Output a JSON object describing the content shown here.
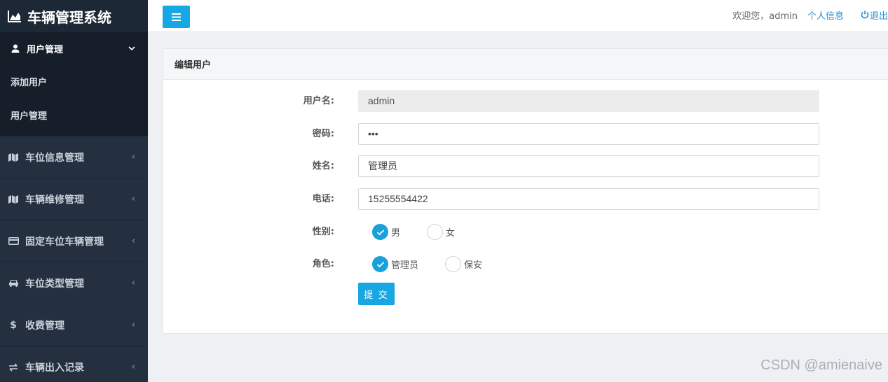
{
  "app": {
    "title": "车辆管理系统",
    "logo_icon": "area-chart-icon"
  },
  "sidebar": {
    "open_menu": {
      "label": "用户管理",
      "icon": "user-icon",
      "expanded": true,
      "items": [
        {
          "label": "添加用户"
        },
        {
          "label": "用户管理"
        }
      ]
    },
    "items": [
      {
        "label": "车位信息管理",
        "icon": "map-icon"
      },
      {
        "label": "车辆维修管理",
        "icon": "map-icon"
      },
      {
        "label": "固定车位车辆管理",
        "icon": "credit-card-icon"
      },
      {
        "label": "车位类型管理",
        "icon": "car-icon"
      },
      {
        "label": "收费管理",
        "icon": "dollar-icon"
      },
      {
        "label": "车辆出入记录",
        "icon": "exchange-icon"
      }
    ]
  },
  "topbar": {
    "menu_toggle_icon": "bars-icon",
    "welcome": "欢迎您，admin",
    "profile_link": "个人信息",
    "logout_link": "退出",
    "logout_icon": "power-icon"
  },
  "form": {
    "title": "编辑用户",
    "fields": {
      "username": {
        "label": "用户名:",
        "value": "admin",
        "disabled": true
      },
      "password": {
        "label": "密码:",
        "value": "•••"
      },
      "name": {
        "label": "姓名:",
        "value": "管理员"
      },
      "phone": {
        "label": "电话:",
        "value": "15255554422"
      }
    },
    "gender": {
      "label": "性别:",
      "options": [
        {
          "label": "男",
          "checked": true
        },
        {
          "label": "女",
          "checked": false
        }
      ]
    },
    "role": {
      "label": "角色:",
      "options": [
        {
          "label": "管理员",
          "checked": true
        },
        {
          "label": "保安",
          "checked": false
        }
      ]
    },
    "submit_label": "提 交"
  },
  "watermark": "CSDN @amienaive",
  "colors": {
    "accent": "#17a7e2",
    "sidebar_bg": "#243040",
    "submenu_bg": "#151e29",
    "link": "#2a8fd0"
  }
}
